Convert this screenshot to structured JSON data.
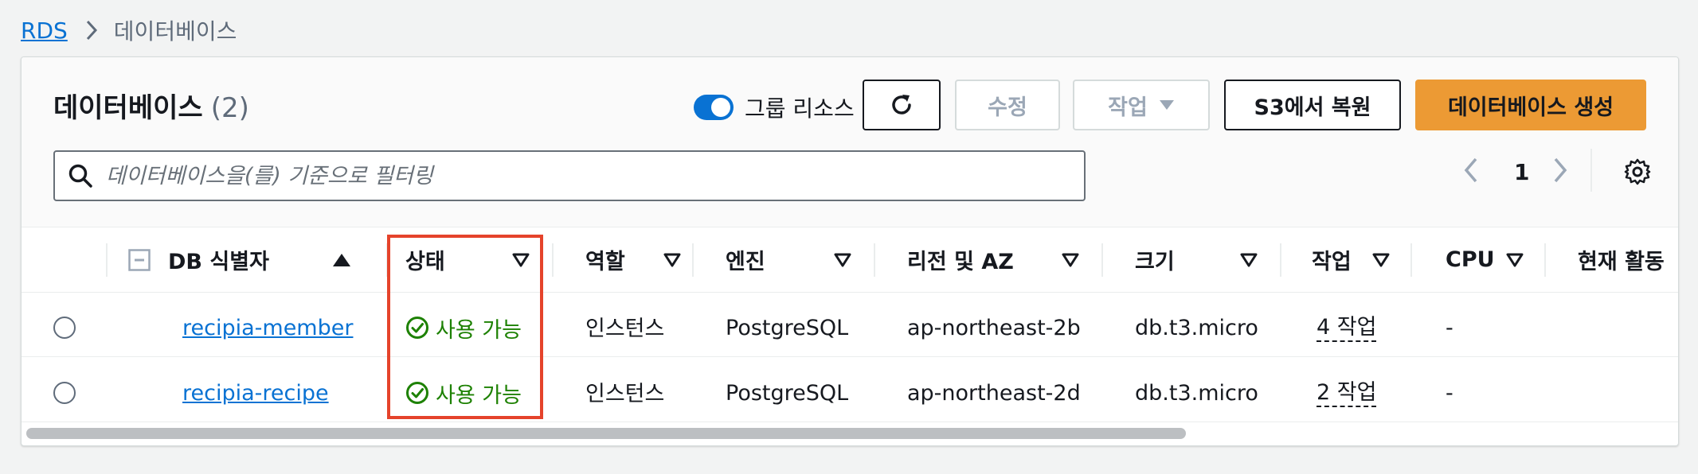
{
  "breadcrumb": {
    "root": "RDS",
    "current": "데이터베이스"
  },
  "header": {
    "title": "데이터베이스",
    "count": "(2)",
    "toggle_label": "그룹 리소스",
    "toggle_on": true,
    "buttons": {
      "modify": "수정",
      "actions": "작업",
      "restore_s3": "S3에서 복원",
      "create": "데이터베이스 생성"
    }
  },
  "search": {
    "placeholder": "데이터베이스을(를) 기준으로 필터링"
  },
  "pagination": {
    "page": "1"
  },
  "table": {
    "columns": [
      "DB 식별자",
      "상태",
      "역할",
      "엔진",
      "리전 및 AZ",
      "크기",
      "작업",
      "CPU",
      "현재 활동"
    ],
    "rows": [
      {
        "id": "recipia-member",
        "status": "사용 가능",
        "role": "인스턴스",
        "engine": "PostgreSQL",
        "region": "ap-northeast-2b",
        "size": "db.t3.micro",
        "actions": "4 작업",
        "cpu": "-"
      },
      {
        "id": "recipia-recipe",
        "status": "사용 가능",
        "role": "인스턴스",
        "engine": "PostgreSQL",
        "region": "ap-northeast-2d",
        "size": "db.t3.micro",
        "actions": "2 작업",
        "cpu": "-"
      }
    ]
  },
  "colors": {
    "link": "#0972d3",
    "primary": "#ec9a34",
    "success": "#1d8102",
    "highlight": "#e5432b"
  }
}
